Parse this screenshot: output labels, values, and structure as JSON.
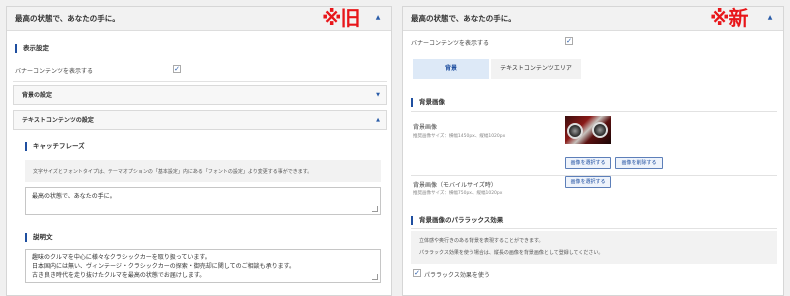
{
  "old": {
    "marker": "※旧",
    "header_title": "最高の状態で、あなたの手に。",
    "display_section": "表示設定",
    "banner_label": "バナーコンテンツを表示する",
    "bg_settings": "背景の設定",
    "text_settings": "テキストコンテンツの設定",
    "catch_heading": "キャッチフレーズ",
    "catch_note": "文字サイズとフォントタイプは、テーマオプションの「基本設定」内にある「フォントの設定」より変更する事ができます。",
    "catch_value": "最高の状態で、あなたの手に。",
    "desc_heading": "説明文",
    "desc_lines": [
      "趣味のクルマを中心に様々なクラシックカーを取り扱っています。",
      "日本国内には無い、ヴィンテージ・クラシックカーの探索・御売却に関してのご相談も承ります。",
      "古き良き時代を走り抜けたクルマを最高の状態でお届けします。"
    ]
  },
  "new": {
    "marker": "※新",
    "header_title": "最高の状態で、あなたの手に。",
    "banner_label": "バナーコンテンツを表示する",
    "tab_bg": "背景",
    "tab_text": "テキストコンテンツエリア",
    "bg_image_section": "背景画像",
    "bg_image_label": "背景画像",
    "bg_image_size": "推奨画像サイズ：横幅1450px、縦幅1020px",
    "select_image": "画像を選択する",
    "delete_image": "画像を削除する",
    "mobile_image_label": "背景画像（モバイルサイズ時）",
    "mobile_image_size": "推奨画像サイズ：横幅750px、縦幅1020px",
    "select_image_mobile": "画像を選択する",
    "parallax_section": "背景画像のパララックス効果",
    "parallax_note_1": "立体感や奥行きのある背景を表現することができます。",
    "parallax_note_2": "パララックス効果を使う場合は、縦長の画像を背景画像として登録してください。",
    "parallax_checkbox": "パララックス効果を使う"
  }
}
